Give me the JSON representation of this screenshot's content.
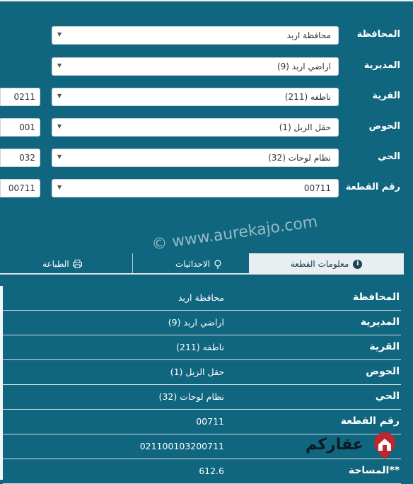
{
  "form": {
    "rows": [
      {
        "label": "المحافظة",
        "value": "محافظة اربد",
        "code": ""
      },
      {
        "label": "المديرية",
        "value": "اراضي اربد (9)",
        "code": ""
      },
      {
        "label": "القرية",
        "value": "ناطفه (211)",
        "code": "0211"
      },
      {
        "label": "الحوض",
        "value": "حقل الزبل (1)",
        "code": "001"
      },
      {
        "label": "الحي",
        "value": "نظام لوحات (32)",
        "code": "032"
      },
      {
        "label": "رقم القطعة",
        "value": "00711",
        "code": "00711"
      }
    ]
  },
  "tabs": {
    "info": "معلومات القطعة",
    "coordinates": "الاحداثيات",
    "print": "الطباعة"
  },
  "watermark": "© www.aurekajo.com",
  "details": [
    {
      "key": "المحافظة",
      "value": "محافظة اربد"
    },
    {
      "key": "المديرية",
      "value": "اراضي اربد (9)"
    },
    {
      "key": "القرية",
      "value": "ناطفه (211)"
    },
    {
      "key": "الحوض",
      "value": "حقل الزبل (1)"
    },
    {
      "key": "الحي",
      "value": "نظام لوحات (32)"
    },
    {
      "key": "رقم القطعة",
      "value": "00711"
    },
    {
      "key": "",
      "value": "021100103200711"
    },
    {
      "key": "**المساحة",
      "value": "612.6"
    }
  ],
  "brand": {
    "name": "عقاركم"
  },
  "colors": {
    "background": "#10667f",
    "tab_active": "#e9eef1",
    "brand_red": "#c0262d"
  }
}
